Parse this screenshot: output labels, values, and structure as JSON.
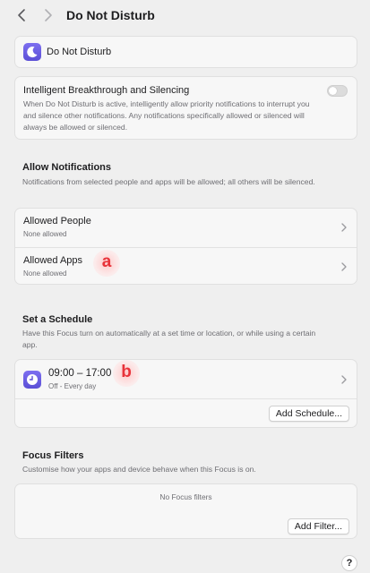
{
  "header": {
    "title": "Do Not Disturb"
  },
  "focus_app": {
    "name": "Do Not Disturb",
    "icon": "moon-icon"
  },
  "intelligent": {
    "title": "Intelligent Breakthrough and Silencing",
    "description": "When Do Not Disturb is active, intelligently allow priority notifications to interrupt you and silence other notifications. Any notifications specifically allowed or silenced will always be allowed or silenced.",
    "enabled": false
  },
  "allow": {
    "title": "Allow Notifications",
    "description": "Notifications from selected people and apps will be allowed; all others will be silenced.",
    "rows": [
      {
        "label": "Allowed People",
        "sub": "None allowed"
      },
      {
        "label": "Allowed Apps",
        "sub": "None allowed"
      }
    ]
  },
  "schedule": {
    "title": "Set a Schedule",
    "description": "Have this Focus turn on automatically at a set time or location, or while using a certain app.",
    "item": {
      "time": "09:00 – 17:00",
      "sub": "Off - Every day",
      "icon": "clock-icon"
    },
    "add_label": "Add Schedule..."
  },
  "filters": {
    "title": "Focus Filters",
    "description": "Customise how your apps and device behave when this Focus is on.",
    "empty": "No Focus filters",
    "add_label": "Add Filter..."
  },
  "markers": {
    "a": "a",
    "b": "b"
  },
  "help_label": "?",
  "colors": {
    "accent": "#6a5de6",
    "marker": "#e8333a"
  }
}
